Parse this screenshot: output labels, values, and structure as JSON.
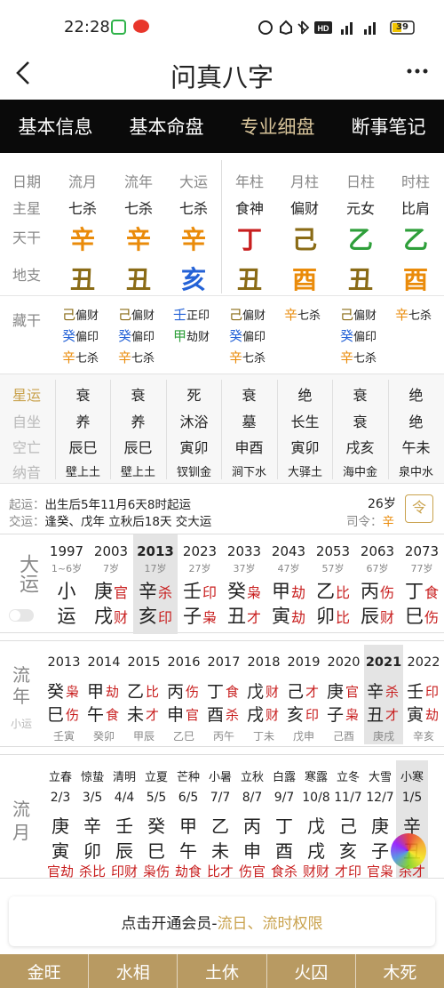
{
  "status": {
    "time": "22:28",
    "battery": "39",
    "net1": "5G",
    "net2": "4G",
    "hd": "HD"
  },
  "title": "问真八字",
  "colors": {
    "tabbar": "#0a0a0a",
    "active_tab": "#d8c49a",
    "metal": "#ea8b0a",
    "wood": "#2e9f3a",
    "water": "#2462d6",
    "fire": "#c81e1e",
    "earth": "#8a6b16",
    "bottom": "#b89a62"
  },
  "tabs": [
    {
      "label": "基本信息"
    },
    {
      "label": "基本命盘"
    },
    {
      "label": "专业细盘"
    },
    {
      "label": "断事笔记"
    }
  ],
  "pillar": {
    "row_labels": [
      "日期",
      "主星",
      "天干",
      "地支"
    ],
    "cols": [
      {
        "head": "流月",
        "star": "七杀",
        "gan": "辛",
        "zhi": "丑",
        "gc": "orange",
        "zc": "brown"
      },
      {
        "head": "流年",
        "star": "七杀",
        "gan": "辛",
        "zhi": "丑",
        "gc": "orange",
        "zc": "brown"
      },
      {
        "head": "大运",
        "star": "七杀",
        "gan": "辛",
        "zhi": "亥",
        "gc": "orange",
        "zc": "blue"
      },
      {
        "head": "年柱",
        "star": "食神",
        "gan": "丁",
        "zhi": "丑",
        "gc": "red",
        "zc": "brown"
      },
      {
        "head": "月柱",
        "star": "偏财",
        "gan": "己",
        "zhi": "酉",
        "gc": "brown",
        "zc": "orange"
      },
      {
        "head": "日柱",
        "star": "元女",
        "gan": "乙",
        "zhi": "丑",
        "gc": "green",
        "zc": "brown"
      },
      {
        "head": "时柱",
        "star": "比肩",
        "gan": "乙",
        "zhi": "酉",
        "gc": "green",
        "zc": "orange"
      }
    ]
  },
  "canggan": {
    "label": "藏干",
    "cols": [
      [
        {
          "g": "己",
          "gc": "brown",
          "s": "偏财"
        },
        {
          "g": "癸",
          "gc": "blue",
          "s": "偏印"
        },
        {
          "g": "辛",
          "gc": "orange",
          "s": "七杀"
        }
      ],
      [
        {
          "g": "己",
          "gc": "brown",
          "s": "偏财"
        },
        {
          "g": "癸",
          "gc": "blue",
          "s": "偏印"
        },
        {
          "g": "辛",
          "gc": "orange",
          "s": "七杀"
        }
      ],
      [
        {
          "g": "壬",
          "gc": "blue",
          "s": "正印"
        },
        {
          "g": "甲",
          "gc": "green",
          "s": "劫财"
        }
      ],
      [
        {
          "g": "己",
          "gc": "brown",
          "s": "偏财"
        },
        {
          "g": "癸",
          "gc": "blue",
          "s": "偏印"
        },
        {
          "g": "辛",
          "gc": "orange",
          "s": "七杀"
        }
      ],
      [
        {
          "g": "辛",
          "gc": "orange",
          "s": "七杀"
        }
      ],
      [
        {
          "g": "己",
          "gc": "brown",
          "s": "偏财"
        },
        {
          "g": "癸",
          "gc": "blue",
          "s": "偏印"
        },
        {
          "g": "辛",
          "gc": "orange",
          "s": "七杀"
        }
      ],
      [
        {
          "g": "辛",
          "gc": "orange",
          "s": "七杀"
        }
      ]
    ]
  },
  "xingyun": {
    "labels": [
      "星运",
      "自坐",
      "空亡",
      "纳音"
    ],
    "cols": [
      [
        "衰",
        "养",
        "辰巳",
        "壁上土"
      ],
      [
        "衰",
        "养",
        "辰巳",
        "壁上土"
      ],
      [
        "死",
        "沐浴",
        "寅卯",
        "钗钏金"
      ],
      [
        "衰",
        "墓",
        "申酉",
        "涧下水"
      ],
      [
        "绝",
        "长生",
        "寅卯",
        "大驿土"
      ],
      [
        "衰",
        "衰",
        "戌亥",
        "海中金"
      ],
      [
        "绝",
        "绝",
        "午未",
        "泉中水"
      ]
    ]
  },
  "qiyun": {
    "line1_label": "起运：",
    "line1": "出生后5年11月6天8时起运",
    "line2_label": "交运：",
    "line2": "逢癸、戊年 立秋后18天 交大运",
    "age": "26岁",
    "siling_label": "司令：",
    "siling": "辛",
    "icon_char": "令"
  },
  "dayun": {
    "label": "大运",
    "cols": [
      {
        "year": "1997",
        "age": "1~6岁",
        "g": "小",
        "z": "运",
        "gs": "",
        "zs": "",
        "gc": "",
        "zc": "",
        "xiao": true
      },
      {
        "year": "2003",
        "age": "7岁",
        "g": "庚",
        "z": "戌",
        "gs": "官",
        "zs": "财"
      },
      {
        "year": "2013",
        "age": "17岁",
        "g": "辛",
        "z": "亥",
        "gs": "杀",
        "zs": "印",
        "sel": true
      },
      {
        "year": "2023",
        "age": "27岁",
        "g": "壬",
        "z": "子",
        "gs": "印",
        "zs": "枭"
      },
      {
        "year": "2033",
        "age": "37岁",
        "g": "癸",
        "z": "丑",
        "gs": "枭",
        "zs": "才"
      },
      {
        "year": "2043",
        "age": "47岁",
        "g": "甲",
        "z": "寅",
        "gs": "劫",
        "zs": "劫"
      },
      {
        "year": "2053",
        "age": "57岁",
        "g": "乙",
        "z": "卯",
        "gs": "比",
        "zs": "比"
      },
      {
        "year": "2063",
        "age": "67岁",
        "g": "丙",
        "z": "辰",
        "gs": "伤",
        "zs": "财"
      },
      {
        "year": "2073",
        "age": "77岁",
        "g": "丁",
        "z": "巳",
        "gs": "食",
        "zs": "伤"
      }
    ]
  },
  "liunian": {
    "label": "流年",
    "sub": "小运",
    "cols": [
      {
        "year": "2013",
        "g": "癸",
        "z": "巳",
        "gs": "枭",
        "zs": "伤",
        "x": "壬寅"
      },
      {
        "year": "2014",
        "g": "甲",
        "z": "午",
        "gs": "劫",
        "zs": "食",
        "x": "癸卯"
      },
      {
        "year": "2015",
        "g": "乙",
        "z": "未",
        "gs": "比",
        "zs": "才",
        "x": "甲辰"
      },
      {
        "year": "2016",
        "g": "丙",
        "z": "申",
        "gs": "伤",
        "zs": "官",
        "x": "乙巳"
      },
      {
        "year": "2017",
        "g": "丁",
        "z": "酉",
        "gs": "食",
        "zs": "杀",
        "x": "丙午"
      },
      {
        "year": "2018",
        "g": "戊",
        "z": "戌",
        "gs": "财",
        "zs": "财",
        "x": "丁未"
      },
      {
        "year": "2019",
        "g": "己",
        "z": "亥",
        "gs": "才",
        "zs": "印",
        "x": "戊申"
      },
      {
        "year": "2020",
        "g": "庚",
        "z": "子",
        "gs": "官",
        "zs": "枭",
        "x": "己酉"
      },
      {
        "year": "2021",
        "g": "辛",
        "z": "丑",
        "gs": "杀",
        "zs": "才",
        "x": "庚戌",
        "sel": true
      },
      {
        "year": "2022",
        "g": "壬",
        "z": "寅",
        "gs": "印",
        "zs": "劫",
        "x": "辛亥"
      }
    ]
  },
  "liuyue": {
    "label": "流月",
    "cols": [
      {
        "jie": "立春",
        "date": "2/3",
        "g": "庚",
        "z": "寅",
        "s": "官劫"
      },
      {
        "jie": "惊蛰",
        "date": "3/5",
        "g": "辛",
        "z": "卯",
        "s": "杀比"
      },
      {
        "jie": "清明",
        "date": "4/4",
        "g": "壬",
        "z": "辰",
        "s": "印财"
      },
      {
        "jie": "立夏",
        "date": "5/5",
        "g": "癸",
        "z": "巳",
        "s": "枭伤"
      },
      {
        "jie": "芒种",
        "date": "6/5",
        "g": "甲",
        "z": "午",
        "s": "劫食"
      },
      {
        "jie": "小暑",
        "date": "7/7",
        "g": "乙",
        "z": "未",
        "s": "比才"
      },
      {
        "jie": "立秋",
        "date": "8/7",
        "g": "丙",
        "z": "申",
        "s": "伤官"
      },
      {
        "jie": "白露",
        "date": "9/7",
        "g": "丁",
        "z": "酉",
        "s": "食杀"
      },
      {
        "jie": "寒露",
        "date": "10/8",
        "g": "戊",
        "z": "戌",
        "s": "财财"
      },
      {
        "jie": "立冬",
        "date": "11/7",
        "g": "己",
        "z": "亥",
        "s": "才印"
      },
      {
        "jie": "大雪",
        "date": "12/7",
        "g": "庚",
        "z": "子",
        "s": "官枭"
      },
      {
        "jie": "小寒",
        "date": "1/5",
        "g": "辛",
        "z": "丑",
        "s": "杀才",
        "sel": true
      }
    ]
  },
  "vip": {
    "prefix": "点击开通会员-",
    "link": "流日、流时权限"
  },
  "bottom": [
    "金旺",
    "水相",
    "土休",
    "火囚",
    "木死"
  ]
}
